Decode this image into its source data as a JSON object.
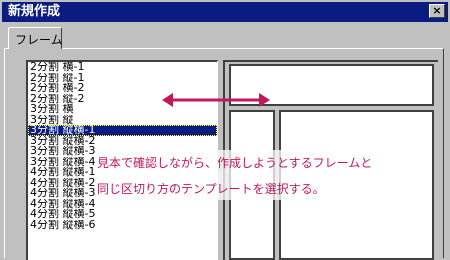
{
  "window": {
    "title": "新規作成",
    "close_label": "×"
  },
  "tabs": [
    {
      "label": "フレーム"
    }
  ],
  "template_list": {
    "items": [
      "2分割 横-1",
      "2分割 縦-1",
      "2分割 横-2",
      "2分割 縦-2",
      "3分割 横",
      "3分割 縦",
      "3分割 縦横-1",
      "3分割 縦横-2",
      "3分割 縦横-3",
      "3分割 縦横-4",
      "4分割 縦横-1",
      "4分割 縦横-2",
      "4分割 縦横-3",
      "4分割 縦横-4",
      "4分割 縦横-5",
      "4分割 縦横-6"
    ],
    "selected_index": 6
  },
  "annotation": {
    "line1": "見本で確認しながら、作成しようとするフレームと",
    "line2": "同じ区切り方のテンプレートを選択する。",
    "color": "#c2185b"
  },
  "colors": {
    "titlebar": "#0a1b82",
    "face": "#c0c0c0",
    "selection": "#0a1b82"
  }
}
